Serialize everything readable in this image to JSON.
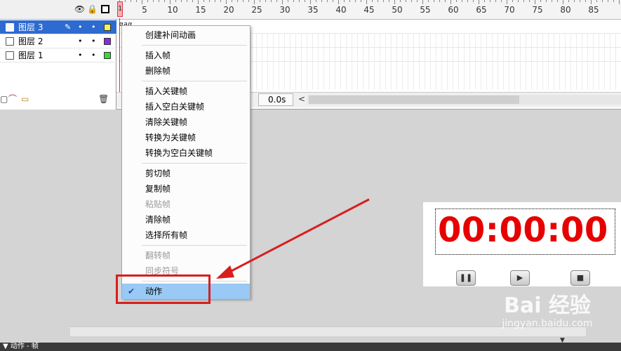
{
  "layers": [
    {
      "name": "图层 3",
      "selected": true,
      "editing": true,
      "color": "#f2f25a"
    },
    {
      "name": "图层 2",
      "selected": false,
      "editing": false,
      "color": "#8a2be2"
    },
    {
      "name": "图层 1",
      "selected": false,
      "editing": false,
      "color": "#3bd63b"
    }
  ],
  "layer_header": {
    "eye_icon": "eye-icon",
    "lock_icon": "lock-icon",
    "outline_icon": "outline-square-icon"
  },
  "layer_footer": {
    "add_icon": "add-layer-icon",
    "guide_icon": "add-motion-guide-icon",
    "folder_icon": "add-folder-icon",
    "trash_icon": "trash-icon"
  },
  "ruler": {
    "playhead": "1",
    "ticks": [
      "5",
      "10",
      "15",
      "20",
      "25",
      "30",
      "35",
      "40",
      "45",
      "50",
      "55",
      "60",
      "65",
      "70",
      "75",
      "80",
      "85"
    ]
  },
  "frame_marks": "αaα",
  "timeline_status": {
    "time": "0.0s",
    "scroll_left": "<"
  },
  "context_menu": {
    "items": [
      {
        "label": "创建补间动画",
        "disabled": false
      },
      {
        "sep": true
      },
      {
        "label": "插入帧",
        "disabled": false
      },
      {
        "label": "删除帧",
        "disabled": false
      },
      {
        "sep": true
      },
      {
        "label": "插入关键帧",
        "disabled": false
      },
      {
        "label": "插入空白关键帧",
        "disabled": false
      },
      {
        "label": "清除关键帧",
        "disabled": false
      },
      {
        "label": "转换为关键帧",
        "disabled": false
      },
      {
        "label": "转换为空白关键帧",
        "disabled": false
      },
      {
        "sep": true
      },
      {
        "label": "剪切帧",
        "disabled": false
      },
      {
        "label": "复制帧",
        "disabled": false
      },
      {
        "label": "粘贴帧",
        "disabled": true
      },
      {
        "label": "清除帧",
        "disabled": false
      },
      {
        "label": "选择所有帧",
        "disabled": false
      },
      {
        "sep": true
      },
      {
        "label": "翻转帧",
        "disabled": true
      },
      {
        "label": "同步符号",
        "disabled": true
      },
      {
        "sep": true
      },
      {
        "label": "动作",
        "disabled": false,
        "checked": true,
        "highlight": true
      }
    ]
  },
  "stage": {
    "timer_text": "00:00:00",
    "timer_color": "#e60000",
    "buttons": [
      {
        "name": "pause",
        "glyph": "❚❚",
        "icon": "pause-icon"
      },
      {
        "name": "play",
        "glyph": "▶",
        "icon": "play-icon"
      },
      {
        "name": "stop",
        "glyph": "■",
        "icon": "stop-icon"
      }
    ]
  },
  "annotation": {
    "color": "#d81e1e"
  },
  "actions_panel": {
    "title": "▼ 动作 - 帧"
  },
  "watermark": {
    "logo": "Bai 经验",
    "url": "jingyan.baidu.com"
  }
}
